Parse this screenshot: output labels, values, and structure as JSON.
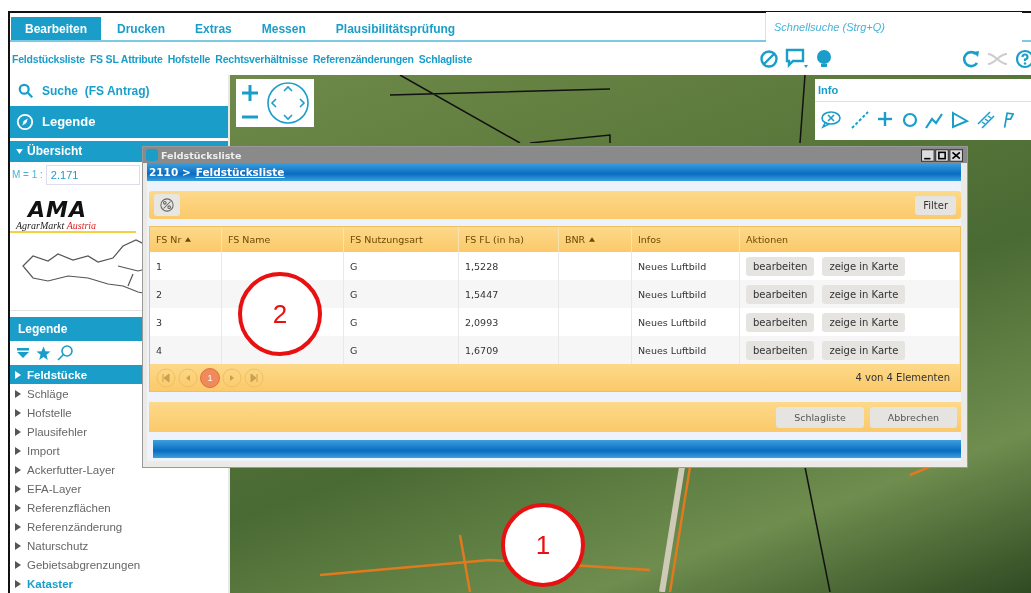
{
  "tabs": [
    {
      "label": "Bearbeiten",
      "selected": true
    },
    {
      "label": "Drucken",
      "selected": false
    },
    {
      "label": "Extras",
      "selected": false
    },
    {
      "label": "Messen",
      "selected": false
    },
    {
      "label": "Plausibilitätsprüfung",
      "selected": false
    }
  ],
  "quick_search": {
    "placeholder": "Schnellsuche (Strg+Q)"
  },
  "toolbar_links": [
    "Feldstücksliste",
    "FS SL Attribute",
    "Hofstelle",
    "Rechtsverhältnisse",
    "Referenzänderungen",
    "Schlagliste"
  ],
  "sidebar": {
    "search": "Suche  (FS Antrag)",
    "legend_button": "Legende",
    "overview": {
      "title": "Übersicht",
      "expanded": true,
      "scale_label": "M = 1 :",
      "scale_value": "2.171",
      "logo": {
        "mark": "AMA",
        "name": "AgrarMarkt",
        "country": "Austria"
      }
    },
    "legend": {
      "title": "Legende",
      "items": [
        {
          "label": "Feldstücke",
          "selected": true,
          "active": true
        },
        {
          "label": "Schläge",
          "selected": false,
          "active": false
        },
        {
          "label": "Hofstelle",
          "selected": false,
          "active": false
        },
        {
          "label": "Plausifehler",
          "selected": false,
          "active": false
        },
        {
          "label": "Import",
          "selected": false,
          "active": false
        },
        {
          "label": "Ackerfutter-Layer",
          "selected": false,
          "active": false
        },
        {
          "label": "EFA-Layer",
          "selected": false,
          "active": false
        },
        {
          "label": "Referenzflächen",
          "selected": false,
          "active": false
        },
        {
          "label": "Referenzänderung",
          "selected": false,
          "active": false
        },
        {
          "label": "Naturschutz",
          "selected": false,
          "active": false
        },
        {
          "label": "Gebietsabgrenzungen",
          "selected": false,
          "active": false
        },
        {
          "label": "Kataster",
          "selected": false,
          "active": true
        }
      ]
    }
  },
  "info_panel": {
    "title": "Info"
  },
  "dialog": {
    "title": "Feldstücksliste",
    "breadcrumb": {
      "prefix": "2110 >",
      "link": "Feldstücksliste"
    },
    "filter_button": "Filter",
    "columns": [
      {
        "label": "FS Nr",
        "sorted": true
      },
      {
        "label": "FS Name",
        "sorted": false
      },
      {
        "label": "FS Nutzungsart",
        "sorted": false
      },
      {
        "label": "FS FL (in ha)",
        "sorted": false
      },
      {
        "label": "BNR",
        "sorted": true
      },
      {
        "label": "Infos",
        "sorted": false
      },
      {
        "label": "Aktionen",
        "sorted": false
      }
    ],
    "rows": [
      {
        "fs_nr": "1",
        "fs_nutzungsart": "G",
        "fs_fl": "1,5228",
        "infos": "Neues Luftbild",
        "actions": [
          "bearbeiten",
          "zeige in Karte"
        ]
      },
      {
        "fs_nr": "2",
        "fs_nutzungsart": "G",
        "fs_fl": "1,5447",
        "infos": "Neues Luftbild",
        "actions": [
          "bearbeiten",
          "zeige in Karte"
        ]
      },
      {
        "fs_nr": "3",
        "fs_nutzungsart": "G",
        "fs_fl": "2,0993",
        "infos": "Neues Luftbild",
        "actions": [
          "bearbeiten",
          "zeige in Karte"
        ]
      },
      {
        "fs_nr": "4",
        "fs_nutzungsart": "G",
        "fs_fl": "1,6709",
        "infos": "Neues Luftbild",
        "actions": [
          "bearbeiten",
          "zeige in Karte"
        ]
      }
    ],
    "pages": [
      {
        "label": "1",
        "selected": true
      }
    ],
    "count": "4 von 4 Elementen",
    "buttons": [
      "Schlagliste",
      "Abbrechen"
    ]
  },
  "annotations": [
    {
      "label": "2",
      "kind": "circle"
    },
    {
      "label": "1",
      "kind": "circle"
    }
  ]
}
